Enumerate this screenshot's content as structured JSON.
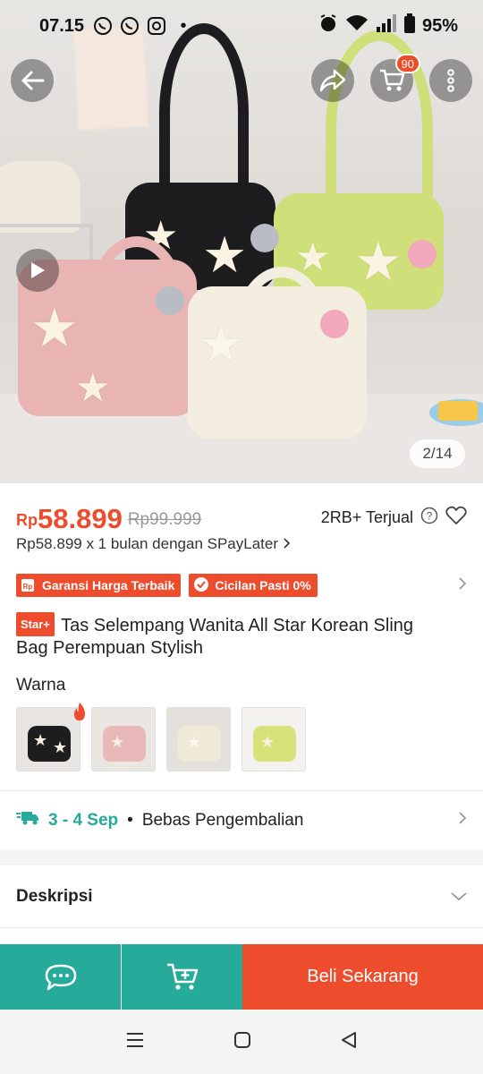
{
  "status_bar": {
    "time": "07.15",
    "battery": "95%"
  },
  "hero": {
    "image_counter": "2/14",
    "cart_count": "90"
  },
  "price": {
    "currency": "Rp",
    "current": "58.899",
    "original": "Rp99.999",
    "sold": "2RB+ Terjual",
    "paylater": "Rp58.899 x 1 bulan dengan SPayLater"
  },
  "badges": [
    {
      "label": "Garansi Harga Terbaik"
    },
    {
      "label": "Cicilan Pasti 0%"
    }
  ],
  "product": {
    "tag": "Star+",
    "title": "Tas Selempang Wanita All Star Korean Sling Bag Perempuan Stylish"
  },
  "variants": {
    "label": "Warna",
    "colors": [
      "#1d1d1f",
      "#e9b9b9",
      "#efe9d8",
      "#d7e37a"
    ]
  },
  "delivery": {
    "eta": "3 - 4 Sep",
    "returns": "Bebas Pengembalian"
  },
  "description": {
    "label": "Deskripsi"
  },
  "actions": {
    "buy_label": "Beli Sekarang"
  },
  "colors": {
    "accent": "#ee4d2d",
    "teal": "#26aa99"
  }
}
